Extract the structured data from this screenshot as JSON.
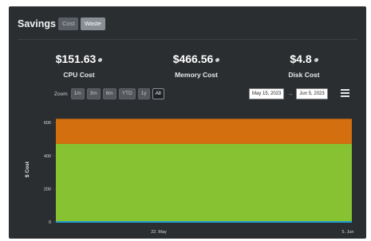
{
  "header": {
    "title": "Savings",
    "toggle_cost": "Cost",
    "toggle_waste": "Waste"
  },
  "metrics": [
    {
      "value": "$151.63",
      "label": "CPU Cost"
    },
    {
      "value": "$466.56",
      "label": "Memory Cost"
    },
    {
      "value": "$4.8",
      "label": "Disk Cost"
    }
  ],
  "zoom": {
    "label": "Zoom",
    "buttons": [
      "1m",
      "3m",
      "6m",
      "YTD",
      "1y",
      "All"
    ],
    "active": "All"
  },
  "range": {
    "from": "May 15, 2023",
    "separator": "→",
    "to": "Jun 5, 2023"
  },
  "colors": {
    "memory": "#86c232",
    "cpu": "#d36f0e",
    "disk": "#1f9bd1",
    "panel_bg": "#2b2e31"
  },
  "chart_data": {
    "type": "area",
    "stacked": true,
    "ylabel": "$ Cost",
    "yticks": [
      "0",
      "200",
      "400",
      "600"
    ],
    "ylim": [
      0,
      620
    ],
    "xticks": [
      "22. May",
      "5. Jun"
    ],
    "x": [
      "May 15, 2023",
      "Jun 5, 2023"
    ],
    "series": [
      {
        "color": "#1f9bd1",
        "values": [
          4.8,
          4.8
        ]
      },
      {
        "color": "#86c232",
        "values": [
          466.56,
          466.56
        ]
      },
      {
        "color": "#d36f0e",
        "values": [
          151.63,
          151.63
        ]
      }
    ],
    "grid": true,
    "legend": "none"
  },
  "icons": {
    "metric_info": "edit-icon",
    "menu": "hamburger-menu-icon"
  }
}
